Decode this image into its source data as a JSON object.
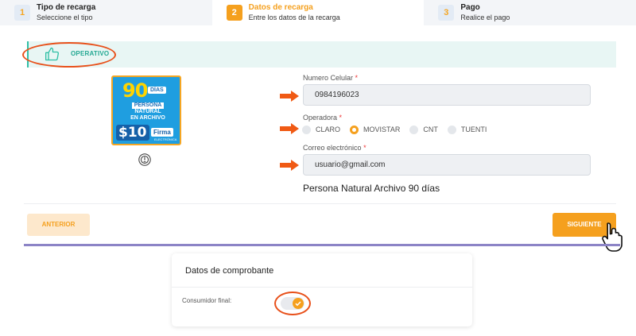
{
  "stepper": {
    "steps": [
      {
        "num": "1",
        "title": "Tipo de recarga",
        "subtitle": "Seleccione el tipo"
      },
      {
        "num": "2",
        "title": "Datos de recarga",
        "subtitle": "Entre los datos de la recarga"
      },
      {
        "num": "3",
        "title": "Pago",
        "subtitle": "Realice el pago"
      }
    ],
    "active_step": 2
  },
  "status": {
    "label": "OPERATIVO",
    "icon": "thumbs-up-icon"
  },
  "product": {
    "image": {
      "days": "90",
      "days_label": "DÍAS",
      "line1": "PERSONA",
      "line2": "NATURAL",
      "line3": "EN ARCHIVO",
      "price": "$10",
      "brand": "Firma",
      "brand_sub": "ELECTRÓNICA"
    },
    "name": "Persona Natural Archivo 90 días"
  },
  "form": {
    "phone": {
      "label": "Numero Celular",
      "required_mark": "*",
      "value": "0984196023"
    },
    "operator": {
      "label": "Operadora",
      "required_mark": "*",
      "options": [
        "CLARO",
        "MOVISTAR",
        "CNT",
        "TUENTI"
      ],
      "selected": "MOVISTAR"
    },
    "email": {
      "label": "Correo electrónico",
      "required_mark": "*",
      "value": "usuario@gmail.com"
    }
  },
  "buttons": {
    "previous": "ANTERIOR",
    "next": "SIGUIENTE"
  },
  "receipt": {
    "title": "Datos de comprobante",
    "consumer_label": "Consumidor final:",
    "consumer_final": true
  },
  "colors": {
    "accent": "#f5a01e",
    "status": "#22a892",
    "annotation": "#e8501a"
  }
}
